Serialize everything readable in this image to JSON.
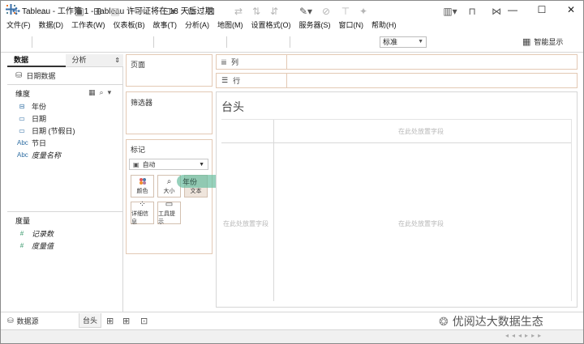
{
  "window": {
    "title": "Tableau - 工作簿 1 - Tableau 许可证将在 13 天后过期",
    "minimize": "—",
    "maximize": "☐",
    "close": "✕"
  },
  "menu": [
    "文件(F)",
    "数据(D)",
    "工作表(W)",
    "仪表板(B)",
    "故事(T)",
    "分析(A)",
    "地图(M)",
    "设置格式(O)",
    "服务器(S)",
    "窗口(N)",
    "帮助(H)"
  ],
  "toolbar": {
    "format_select": "标准",
    "smart_show": "智能显示"
  },
  "data_pane": {
    "tab_data": "数据",
    "tab_analytics": "分析",
    "datasource": "日期数据",
    "dimensions_header": "维度",
    "dimensions": [
      {
        "icon": "calendar-hierarchy-icon",
        "glyph": "▭",
        "label": "年份",
        "italic": false
      },
      {
        "icon": "calendar-icon",
        "glyph": "▭",
        "label": "日期",
        "italic": false
      },
      {
        "icon": "calendar-icon",
        "glyph": "▭",
        "label": "日期 (节假日)",
        "italic": false
      },
      {
        "icon": "string-icon",
        "glyph": "Abc",
        "label": "节日",
        "italic": false
      },
      {
        "icon": "string-icon",
        "glyph": "Abc",
        "label": "度量名称",
        "italic": true
      }
    ],
    "measures_header": "度量",
    "measures": [
      {
        "icon": "number-icon",
        "glyph": "#",
        "label": "记录数",
        "italic": true
      },
      {
        "icon": "number-icon",
        "glyph": "#",
        "label": "度量值",
        "italic": true
      }
    ]
  },
  "shelves": {
    "pages": "页面",
    "filters": "筛选器",
    "marks": "标记",
    "marks_type": "自动",
    "mark_buttons": {
      "color": "颜色",
      "size": "大小",
      "text": "文本",
      "detail": "详细信息",
      "tooltip": "工具提示"
    },
    "columns": "列",
    "rows": "行"
  },
  "view": {
    "title": "台头",
    "drop_top": "在此处放置字段",
    "drop_left": "在此处放置字段",
    "drop_center": "在此处放置字段"
  },
  "drag_pill": {
    "label": "年份"
  },
  "bottom": {
    "datasource_tab": "数据源",
    "sheet_tab": "台头"
  },
  "watermark": "优阅达大数据生态"
}
